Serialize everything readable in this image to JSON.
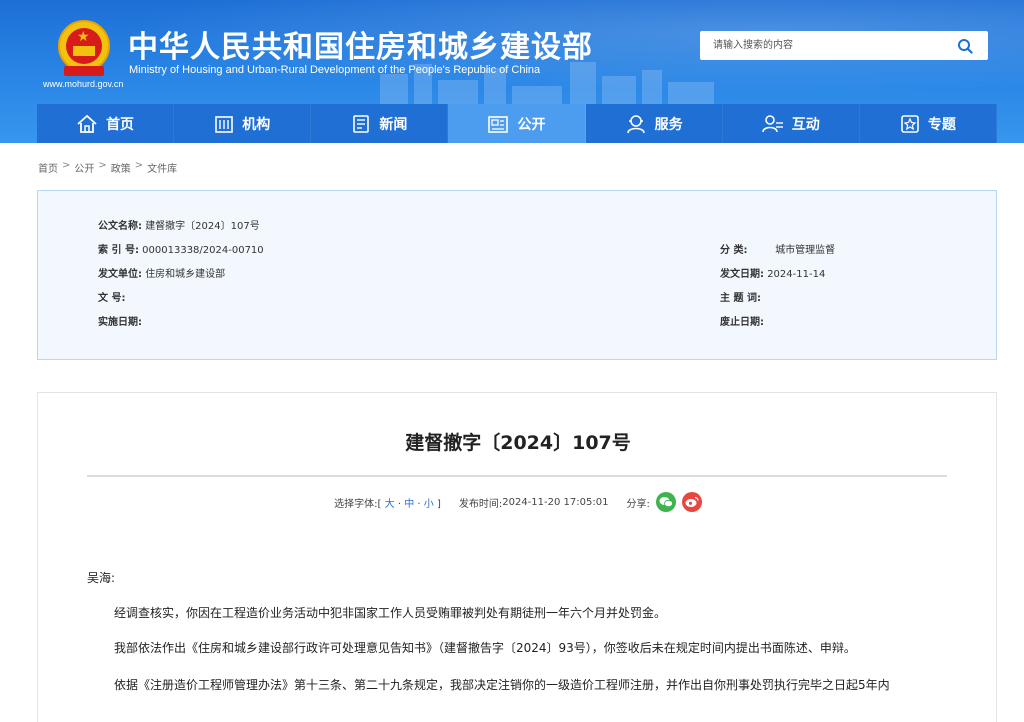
{
  "header": {
    "site_title": "中华人民共和国住房和城乡建设部",
    "site_subtitle": "Ministry of Housing and Urban-Rural Development of the People's Republic of China",
    "site_url": "www.mohurd.gov.cn",
    "search_placeholder": "请输入搜索的内容"
  },
  "nav": {
    "items": [
      {
        "label": "首页",
        "icon": "home-icon"
      },
      {
        "label": "机构",
        "icon": "building-icon"
      },
      {
        "label": "新闻",
        "icon": "news-icon"
      },
      {
        "label": "公开",
        "icon": "disclosure-icon",
        "active": true
      },
      {
        "label": "服务",
        "icon": "service-icon"
      },
      {
        "label": "互动",
        "icon": "interaction-icon"
      },
      {
        "label": "专题",
        "icon": "topic-icon"
      }
    ]
  },
  "breadcrumb": [
    "首页",
    "公开",
    "政策",
    "文件库"
  ],
  "meta": {
    "doc_name_label": "公文名称:",
    "doc_name": "建督撤字〔2024〕107号",
    "index_label": "索 引 号:",
    "index": "000013338/2024-00710",
    "category_label": "分 类:",
    "category": "城市管理监督",
    "issuer_label": "发文单位:",
    "issuer": "住房和城乡建设部",
    "date_label": "发文日期:",
    "date": "2024-11-14",
    "doc_no_label": "文 号:",
    "doc_no": "",
    "keywords_label": "主 题 词:",
    "keywords": "",
    "effective_label": "实施日期:",
    "effective": "",
    "expiry_label": "废止日期:",
    "expiry": ""
  },
  "article": {
    "title": "建督撤字〔2024〕107号",
    "font_select_label": "选择字体:",
    "font_bracket_open": "[",
    "font_large": "大",
    "font_medium": "中",
    "font_small": "小",
    "font_bracket_close": "]",
    "font_dot": "·",
    "publish_label": "发布时间:",
    "publish_time": "2024-11-20 17:05:01",
    "share_label": "分享:",
    "salutation": "吴海:",
    "para1": "经调查核实，你因在工程造价业务活动中犯非国家工作人员受贿罪被判处有期徒刑一年六个月并处罚金。",
    "para2": "我部依法作出《住房和城乡建设部行政许可处理意见告知书》（建督撤告字〔2024〕93号），你签收后未在规定时间内提出书面陈述、申辩。",
    "para3": "依据《注册造价工程师管理办法》第十三条、第二十九条规定，我部决定注销你的一级造价工程师注册，并作出自你刑事处罚执行完毕之日起5年内"
  }
}
